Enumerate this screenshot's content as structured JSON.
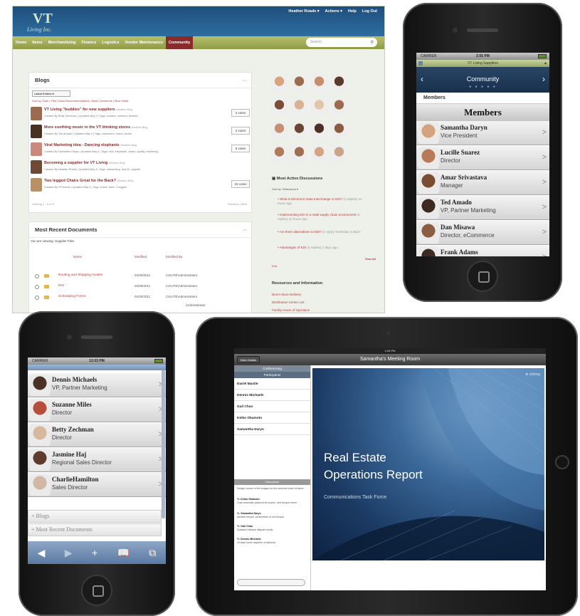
{
  "desktop": {
    "logo": {
      "mark": "VT",
      "tagline": "Living Inc."
    },
    "top_links": [
      "Heather Roads ▾",
      "Actions ▾",
      "Help",
      "Log Out"
    ],
    "nav": [
      "Home",
      "Items",
      "Merchandising",
      "Finance",
      "Logistics",
      "Vendor Maintenance",
      "Community"
    ],
    "search_placeholder": "Search",
    "blogs": {
      "title": "Blogs",
      "select_value": "Latest Entries ▾",
      "sort_links": "Sort by: Date | Title | Most Recommendations | Most Comments | Most Visits",
      "entries": [
        {
          "title": "VT Living \"buddies\" for new suppliers",
          "tag": "Weather Blog",
          "meta": "Created By Betty Zechman | Updated May 6 | Tags: buddies, mentors, buddies",
          "votes": "2 votes",
          "color": "#9a6b4f"
        },
        {
          "title": "More soothing music in the VT thinking stores",
          "tag": "Weather Blog",
          "meta": "Created By Tod Amado | Updated May 4 | Tags: customers, music, stores",
          "votes": "2 votes",
          "color": "#4a3223"
        },
        {
          "title": "Viral Marketing idea - Dancing elephants",
          "tag": "Weather Blog",
          "meta": "Created By Samantha Darye | Updated May 4 | Tags: viral, elephants, chairs, quality, marketing",
          "votes": "6 votes",
          "color": "#c98a7b"
        },
        {
          "title": "Becoming a supplier for VT Living",
          "tag": "Weather Blog",
          "meta": "Created By Heather Roads | Updated May 4 | Tags: onboarding, how-to, supplier",
          "votes": "",
          "color": "#6e4a35"
        },
        {
          "title": "Two legged Chairs Great for the Back?",
          "tag": "Weather Blog",
          "meta": "Created By VP Admin | Updated May 4 | Tags: chairs, back, 2-legged",
          "votes": "15 votes",
          "color": "#b89065"
        }
      ],
      "paging": "Viewing 1 - 5 of 5",
      "pager": "Previous | Next"
    },
    "documents": {
      "title": "Most Recent Documents",
      "subtitle": "You are viewing: Supplier Files",
      "headers": [
        "Name",
        "Modified",
        "Modified By"
      ],
      "rows": [
        {
          "name": "Routing and Shipping Guides",
          "modified": "04/30/2011",
          "by": "CSUITE\\Administrator"
        },
        {
          "name": "EDI",
          "modified": "04/30/2011",
          "by": "CSUITE\\Administrator"
        },
        {
          "name": "Scheduling Forms",
          "modified": "04/30/2011",
          "by": "CSUITE\\Administrator"
        }
      ],
      "footer": "\\Administrator"
    },
    "faces": [
      "#d7a47e",
      "#9b6d4e",
      "#c58d6a",
      "#5a3a2a",
      "#7b4e35",
      "#d9b295",
      "#e2c4a8",
      "#9c6b4e",
      "#c78f72",
      "#6b4634",
      "#4d3124",
      "#8a5d43",
      "#b27b58",
      "#a06f52",
      "#d4a382",
      "#caa38a"
    ],
    "discussions": {
      "title": "Most Active Discussions",
      "sort": "Sort by: Relevance ▾",
      "items": [
        {
          "text": "What is Electronic Data Interchange or EDI?",
          "sub": "(4 replies) 12 hours ago"
        },
        {
          "text": "Implementing EDI in a retail supply chain environment",
          "sub": "(3 replies) 11 hours ago"
        },
        {
          "text": "Are there alternatives to EDI?",
          "sub": "(1 reply) Yesterday 4:25pm"
        },
        {
          "text": "Advantages of EDI",
          "sub": "(4 replies) 2 days ago"
        }
      ],
      "view_all": "View All",
      "edit": "Edit"
    },
    "resources": {
      "title": "Resources and Information",
      "links": [
        "Direct Store Delivery",
        "Distribution Center List",
        "Facility Hours of Operation"
      ]
    }
  },
  "phone_members": {
    "carrier": "CARRIER",
    "time": "3:55 PM",
    "url_title": "VT Living Suppliers",
    "section": "Community",
    "members_label": "Members",
    "members_heading": "Members",
    "members": [
      {
        "name": "Samantha Daryn",
        "role": "Vice President",
        "color": "#d4a37e"
      },
      {
        "name": "Lucille Suarez",
        "role": "Director",
        "color": "#b87a57"
      },
      {
        "name": "Amar Srivastava",
        "role": "Manager",
        "color": "#7a4d33"
      },
      {
        "name": "Ted Amado",
        "role": "VP, Partner Marketing",
        "color": "#3e2a1f"
      },
      {
        "name": "Dan Misawa",
        "role": "Director, eCommerce",
        "color": "#8c5d40"
      },
      {
        "name": "Frank Adams",
        "role": "",
        "color": "#3c2b22"
      }
    ]
  },
  "phone_detail": {
    "carrier": "CARRIER",
    "time": "12:03 PM",
    "members": [
      {
        "name": "Dennis Michaels",
        "role": "VP, Partner Marketing",
        "color": "#4a3326"
      },
      {
        "name": "Suzanne Miles",
        "role": "Director",
        "color": "#b54f3c"
      },
      {
        "name": "Betty Zechman",
        "role": "Director",
        "color": "#d7b79d"
      },
      {
        "name": "Jasmine Haj",
        "role": "Regional Sales Director",
        "color": "#5e3b2c"
      },
      {
        "name": "CharlieHamilton",
        "role": "Sales Director",
        "color": "#d2b8a4"
      }
    ],
    "sections": [
      "+ Blogs",
      "+ Most Recent Documents"
    ],
    "toolbar": [
      "◀",
      "▶",
      "+",
      "📖",
      "⧉"
    ]
  },
  "ipad": {
    "status_time": "4:28 PM",
    "back_button": "Main Details",
    "title": "Samantha's Meeting Room",
    "side_tabs": [
      "Conferencing",
      "Participants"
    ],
    "participants": [
      "Dariel Maxtie",
      "Dennis Michaels",
      "Gail Chao",
      "Keiko Okamoto",
      "Samantha Daryn"
    ],
    "discussion_label": "Discussion",
    "chat": [
      {
        "who": "",
        "text": "Design review of the images for the selected chair furniture"
      },
      {
        "who": "+/- Keiko Okamoto",
        "text": "Cras venenatis placerat leo ipsum, sed tempor lorem"
      },
      {
        "who": "+/- Samantha Daryn",
        "text": "Aenean tempor consectetur ut est tempor"
      },
      {
        "who": "+/- Gail Chao",
        "text": "Quisque tristique aliquam turpis."
      },
      {
        "who": "+/- Dennis Michaels",
        "text": "Ut vitae lorem dapibus ut dictumst"
      }
    ],
    "slide": {
      "logo": "⊕ vtliving",
      "title_line1": "Real Estate",
      "title_line2": "Operations Report",
      "subtitle": "Communications Task Force"
    }
  }
}
